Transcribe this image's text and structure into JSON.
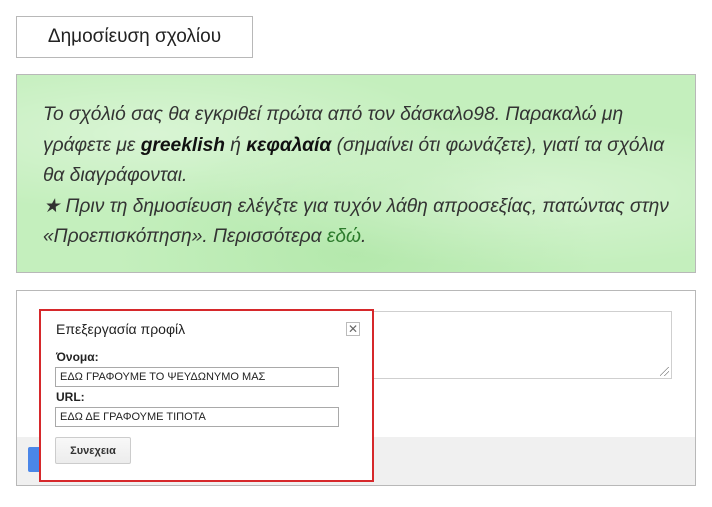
{
  "publish_button": {
    "label": "Δημοσίευση σχολίου"
  },
  "notice": {
    "line1_pre": "Το σχόλιό σας θα εγκριθεί πρώτα από τον δάσκαλο98. Παρακαλώ μη γράφετε με ",
    "greeklish": "greeklish",
    "or": " ή ",
    "capitals": "κεφαλαία",
    "line1_post": " (σημαίνει ότι φωνάζετε), γιατί τα σχόλια θα διαγράφονται.",
    "star": "★",
    "line2": " Πριν τη δημοσίευση ελέγξτε για τυχόν λάθη απροσεξίας, πατώντας στην «Προεπισκόπηση». Περισσότερα ",
    "link": "εδώ",
    "period": "."
  },
  "profile_dialog": {
    "title": "Επεξεργασία προφίλ",
    "close_symbol": "✕",
    "name_label": "Όνομα:",
    "name_value": "ΕΔΩ ΓΡΑΦΟΥΜΕ ΤΟ ΨΕΥΔΩΝΥΜΟ ΜΑΣ",
    "url_label": "URL:",
    "url_value": "ΕΔΩ ΔΕ ΓΡΑΦΟΥΜΕ ΤΙΠΟΤΑ",
    "continue_label": "Συνεχεια"
  },
  "colors": {
    "notice_bg": "#c4efbd",
    "link": "#2c7b2c",
    "dialog_border": "#d6282b",
    "primary_button": "#4a86e8"
  }
}
